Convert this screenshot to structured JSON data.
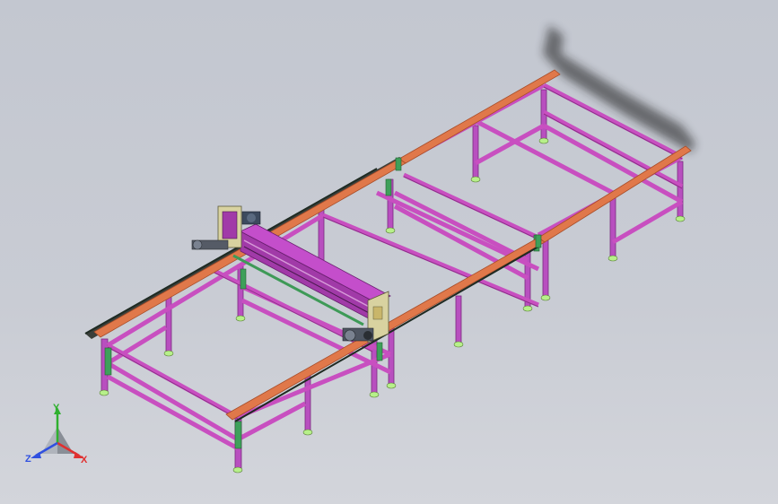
{
  "viewport": {
    "background": "#c6c9d1"
  },
  "colors": {
    "frame": "#c84fc0",
    "frame_dark": "#8e2f8a",
    "rail": "#e0784a",
    "rail_dark": "#a84e2a",
    "leg": "#b84fbf",
    "foot": "#b7f08a",
    "bracket": "#3ea05a",
    "gantry": "#a13aa8",
    "plate": "#d8d2a0",
    "shadow": "#2a2a2a"
  },
  "triad": {
    "x_label": "X",
    "y_label": "Y",
    "z_label": "Z",
    "x_color": "#e03030",
    "y_color": "#2fb02f",
    "z_color": "#3050e0"
  }
}
